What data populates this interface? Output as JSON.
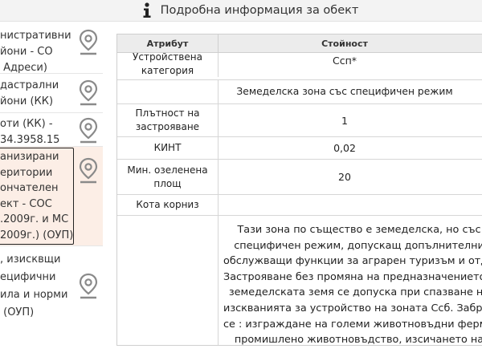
{
  "header": {
    "title": "Подробна информация за обект",
    "icon": "info-icon"
  },
  "sidebar": {
    "items": [
      {
        "label": "нистративни\nйони - СО\n Адреси)",
        "icon": "map-pin-icon"
      },
      {
        "label": "дастрални\nйони (КК)",
        "icon": "map-pin-icon"
      },
      {
        "label": "оти (КК) -\n34.3958.15",
        "icon": "map-pin-icon"
      },
      {
        "label": "анизирани\nеритории\nончателен\nект - СОС\n.2009г. и МС\n2009г.) (ОУП)",
        "icon": "map-pin-icon",
        "active": true
      },
      {
        "label": ", изисквщи\nецифични\nила и норми\n (ОУП)",
        "icon": "map-pin-icon"
      }
    ]
  },
  "table": {
    "header_attr": "Атрибут",
    "header_value": "Стойност",
    "rows": [
      {
        "attr": "Устройствена\nкатегория",
        "value": "Ссп*"
      },
      {
        "attr": "",
        "value": "Земеделска зона със специфичен режим"
      },
      {
        "attr": "Плътност на\nзастрояване",
        "value": "1"
      },
      {
        "attr": "КИНТ",
        "value": "0,02"
      },
      {
        "attr": "Мин. озеленена\nплощ",
        "value": "20"
      },
      {
        "attr": "Кота корниз",
        "value": ""
      },
      {
        "attr": "",
        "value": "Тази зона по същество е земеделска, но със\nспецифичен режим, допускащ допълнителни\nобслужващи функции за аграрен туризъм и отдих.\nЗастрояване без промяна на предназначението на\nземеделската земя се допуска при спазване на\nизскванията за устройство на зоната Ссб. Забранява\nсе : изграждане на големи животновъдни ферми з\nпромишлено животновъдство, изсичането на\nсъществуващата дървесна растителност и"
      }
    ]
  },
  "colors": {
    "header_bg": "#f3f3f3",
    "active_item_bg": "#fceee6",
    "table_header_bg": "#ececec",
    "pin_color": "#8a8a8a"
  }
}
